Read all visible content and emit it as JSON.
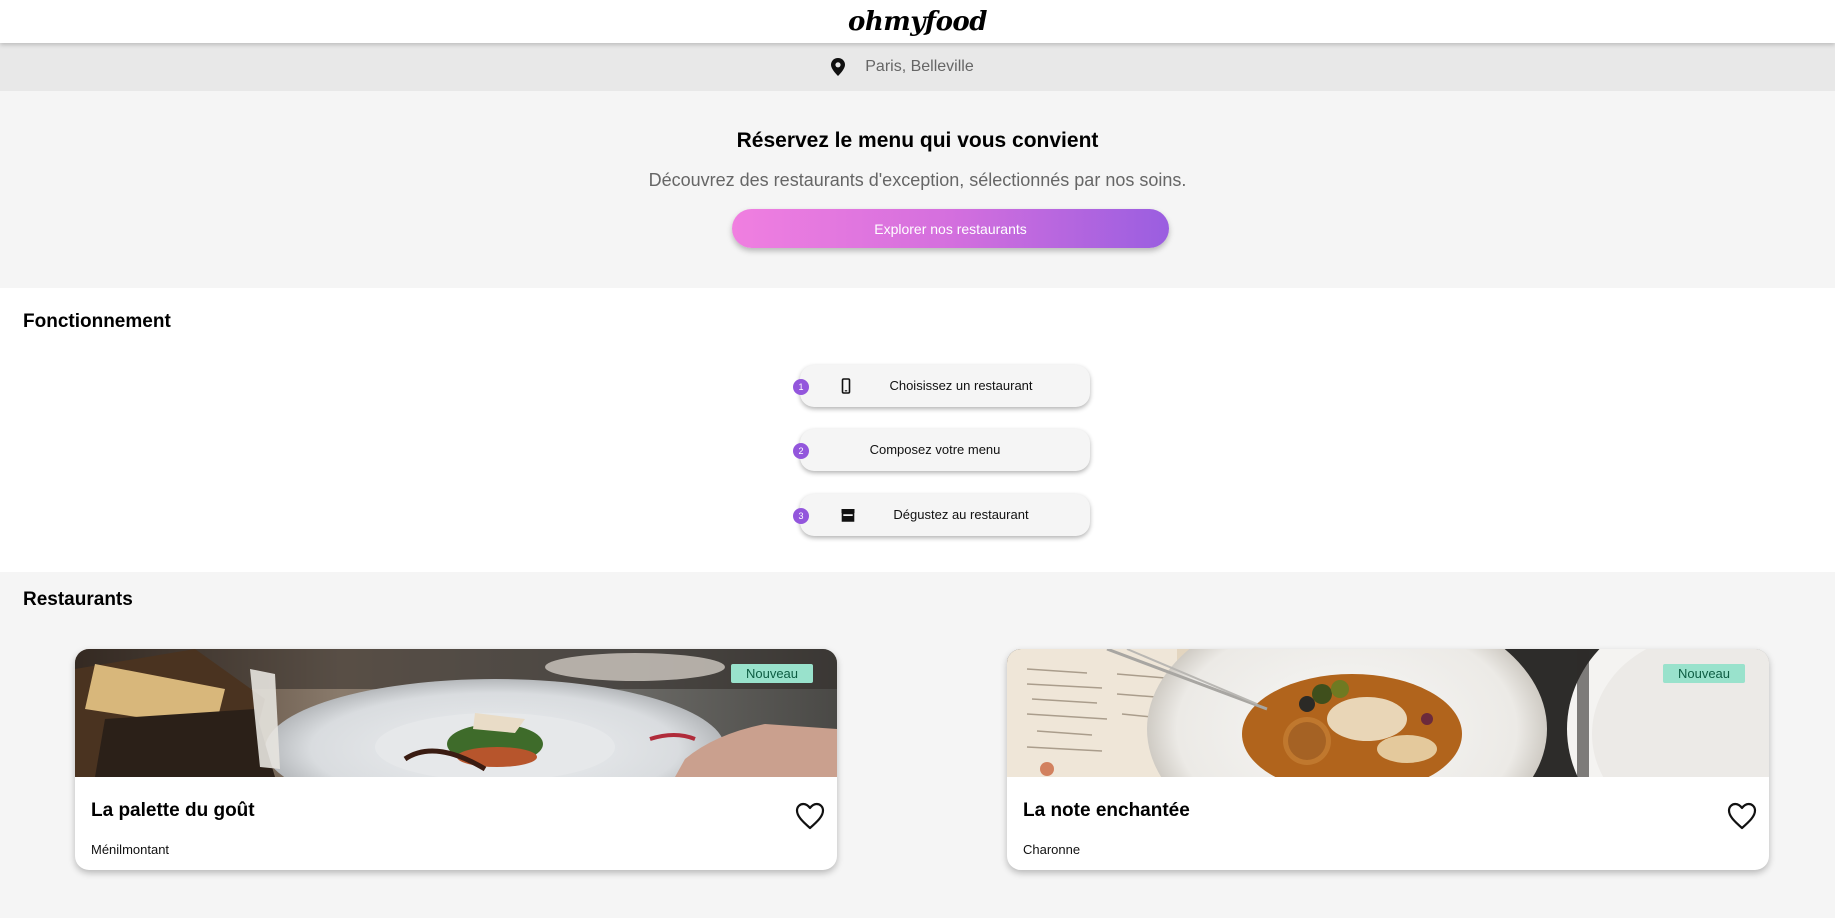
{
  "header": {
    "logo": "ohmyfood"
  },
  "location": {
    "text": "Paris, Belleville",
    "icon": "map-pin-icon"
  },
  "hero": {
    "title": "Réservez le menu qui vous convient",
    "subtitle": "Découvrez des restaurants d'exception, sélectionnés par nos soins.",
    "cta_label": "Explorer nos restaurants",
    "cta_gradient": [
      "#f07fe0",
      "#9a5ee0"
    ]
  },
  "how": {
    "title": "Fonctionnement",
    "steps": [
      {
        "number": "1",
        "label": "Choisissez un restaurant",
        "icon": "mobile-phone-icon"
      },
      {
        "number": "2",
        "label": "Composez votre menu",
        "icon": ""
      },
      {
        "number": "3",
        "label": "Dégustez au restaurant",
        "icon": "store-icon"
      }
    ],
    "number_color": "#9356dc"
  },
  "restaurants": {
    "title": "Restaurants",
    "cards": [
      {
        "name": "La palette du goût",
        "area": "Ménilmontant",
        "badge": "Nouveau",
        "favorite_icon": "heart-outline-icon"
      },
      {
        "name": "La note enchantée",
        "area": "Charonne",
        "badge": "Nouveau",
        "favorite_icon": "heart-outline-icon"
      }
    ],
    "badge_color": "#99e2cc"
  }
}
